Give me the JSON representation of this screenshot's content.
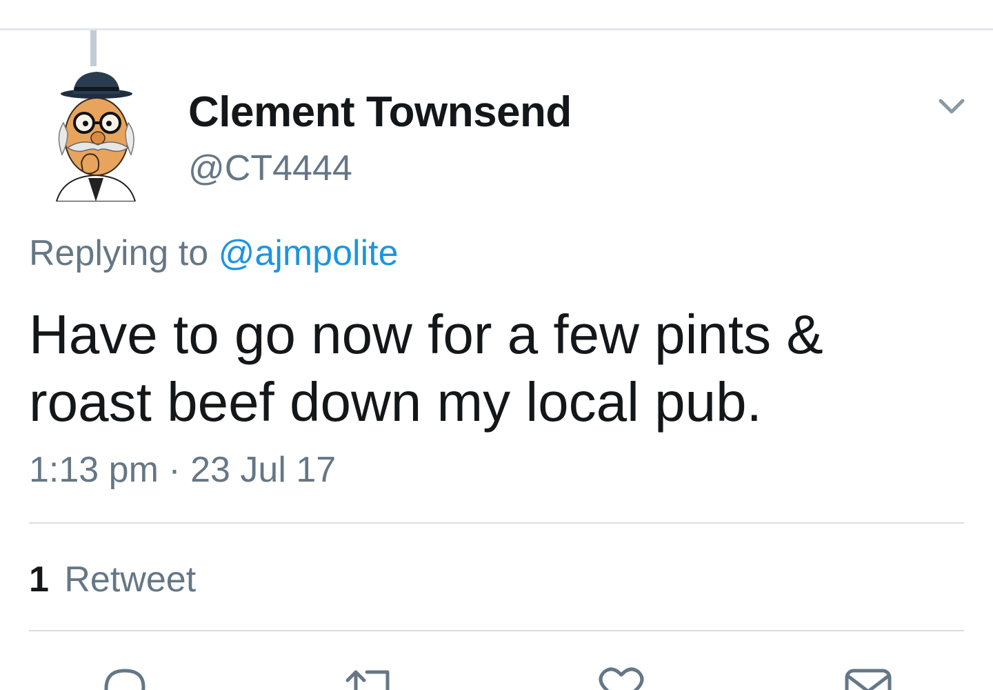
{
  "tweet": {
    "author_name": "Clement Townsend",
    "author_handle": "@CT4444",
    "replying_prefix": "Replying to",
    "replying_handle": "@ajmpolite",
    "text": "Have to go now for a few pints & roast beef down my local pub.",
    "time": "1:13 pm",
    "separator": "·",
    "date": "23 Jul 17",
    "retweet_count": "1",
    "retweet_label": "Retweet"
  },
  "icons": {
    "menu": "chevron-down-icon",
    "actions": [
      "reply-icon",
      "retweet-icon",
      "like-icon",
      "message-icon"
    ]
  },
  "colors": {
    "text_primary": "#14171a",
    "text_secondary": "#657786",
    "link": "#1b95e0",
    "divider": "#d7dde2",
    "thread_line": "#c4ccd3"
  }
}
